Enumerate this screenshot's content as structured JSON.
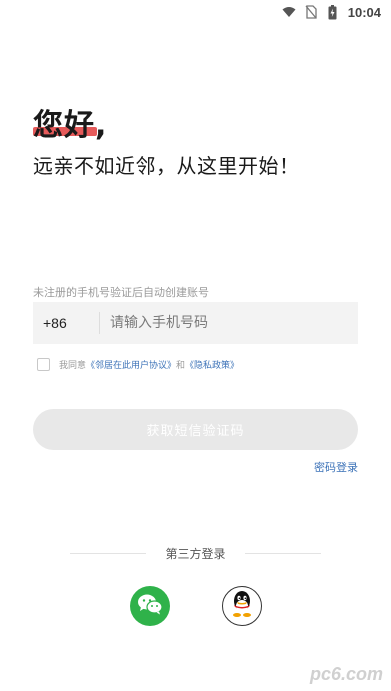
{
  "status_bar": {
    "time": "10:04",
    "icons": [
      "wifi-icon",
      "no-sim-icon",
      "battery-charging-icon"
    ]
  },
  "greeting": {
    "title": "您好,",
    "subtitle": "远亲不如近邻，从这里开始！",
    "accent_color": "#e55a5a"
  },
  "login": {
    "hint": "未注册的手机号验证后自动创建账号",
    "country_code": "+86",
    "phone_placeholder": "请输入手机号码",
    "phone_value": "",
    "agreement": {
      "prefix": "我同意",
      "user_agreement": "《邻居在此用户协议》",
      "connector": "和",
      "privacy_policy": "《隐私政策》",
      "checked": false
    },
    "sms_button_label": "获取短信验证码",
    "password_login_label": "密码登录",
    "link_color": "#3d73b8"
  },
  "third_party": {
    "label": "第三方登录",
    "providers": [
      {
        "name": "WeChat",
        "icon": "wechat-icon",
        "color": "#2fb24a"
      },
      {
        "name": "QQ",
        "icon": "qq-icon",
        "color": "#000000"
      }
    ]
  },
  "watermark": "pc6.com"
}
